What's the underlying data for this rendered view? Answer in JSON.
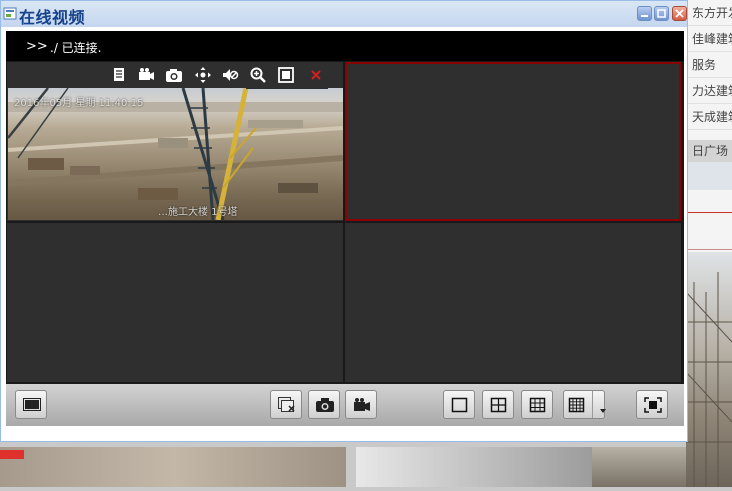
{
  "dialog": {
    "title": "在线视频",
    "window_buttons": [
      "minimize",
      "maximize",
      "close"
    ]
  },
  "status": {
    "arrows": ">>",
    "message": "./ 已连接."
  },
  "video_pane_1": {
    "toolbar_icons": [
      "info-icon",
      "record-icon",
      "snapshot-icon",
      "ptz-icon",
      "mute-icon",
      "zoom-icon",
      "fullscreen-icon",
      "close-icon"
    ],
    "osd_top": "2016年05月 星期 11:40:15",
    "osd_bottom": "…施工大楼 1号塔"
  },
  "controls": {
    "left": [
      "screen-icon"
    ],
    "center": [
      "stop-all-icon",
      "snapshot-icon",
      "record-icon"
    ],
    "layouts": [
      "layout-1-icon",
      "layout-4-icon",
      "layout-9-icon",
      "layout-16-icon"
    ],
    "right": [
      "fullscreen-icon"
    ]
  },
  "background_list": {
    "items": [
      "东方开发",
      "佳峰建筑",
      "服务",
      "力达建筑",
      "天成建筑",
      "日广场"
    ]
  },
  "colors": {
    "title": "#15428b",
    "selected_pane_border": "#8b0000",
    "status_bg": "#000000",
    "pane_bg": "#2f2f2f"
  }
}
